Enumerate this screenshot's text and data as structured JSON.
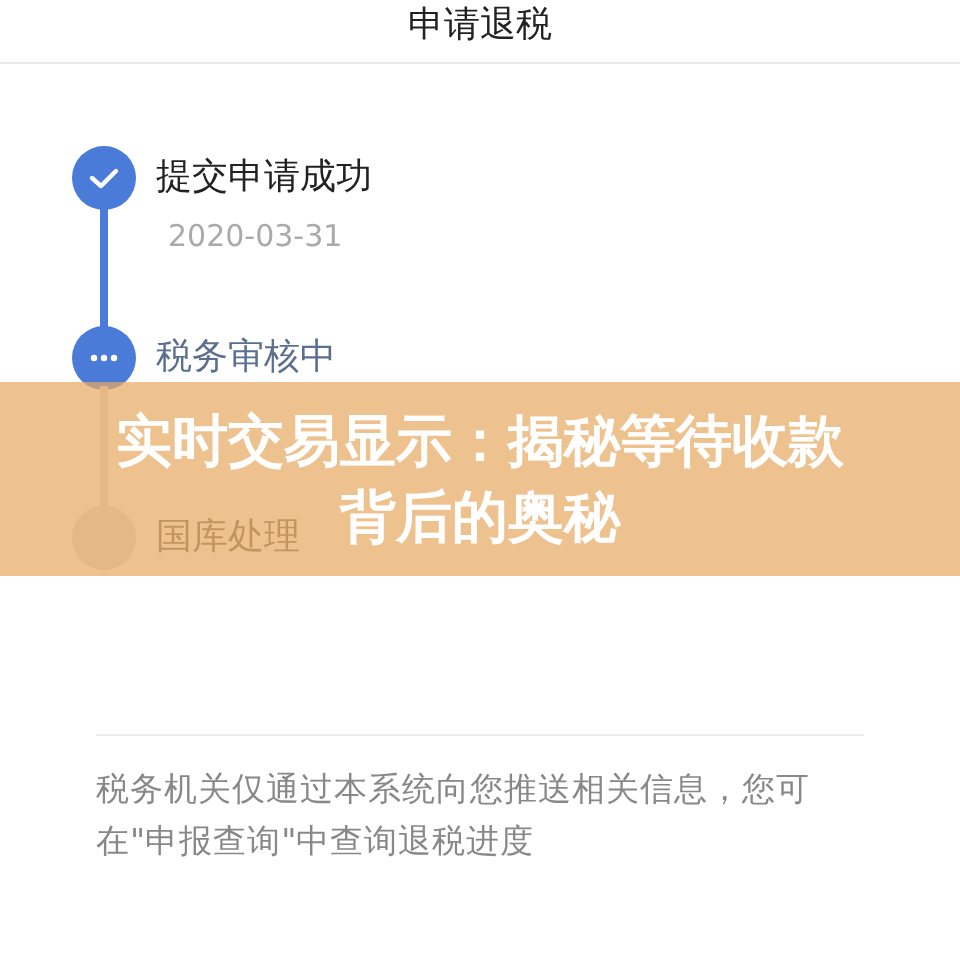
{
  "header": {
    "title": "申请退税"
  },
  "steps": [
    {
      "label": "提交申请成功",
      "date": "2020-03-31",
      "kind": "done"
    },
    {
      "label": "税务审核中",
      "kind": "active"
    },
    {
      "label": "国库处理",
      "kind": "pending"
    }
  ],
  "notice": "税务机关仅通过本系统向您推送相关信息，您可在\"申报查询\"中查询退税进度",
  "banner": {
    "lines": [
      "实时交易显示：揭秘等待收款",
      "背后的奥秘"
    ]
  }
}
